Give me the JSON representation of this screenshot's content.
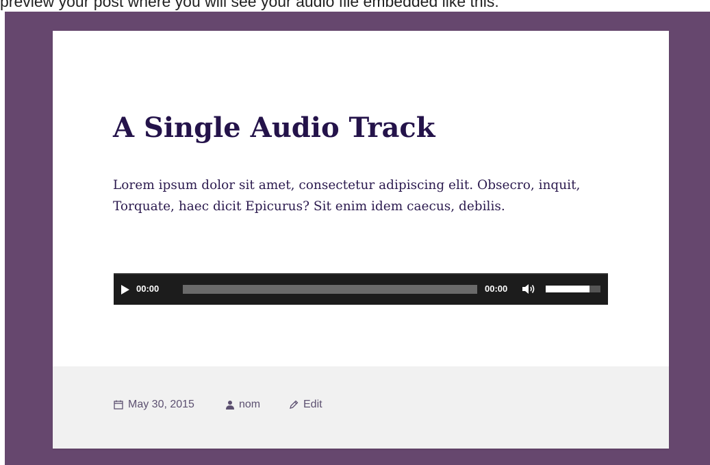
{
  "caption": "preview your post where you will see your audio file embedded like this:",
  "post": {
    "title": "A Single Audio Track",
    "body": "Lorem ipsum dolor sit amet, consectetur adipiscing elit. Obsecro, inquit, Torquate, haec dicit Epicurus? Sit enim idem caecus, debilis."
  },
  "audio_player": {
    "current_time": "00:00",
    "duration": "00:00",
    "progress_fraction": 0,
    "volume_fraction": 0.8,
    "play_icon": "play-icon",
    "mute_icon": "volume-icon"
  },
  "footer": {
    "date": "May 30, 2015",
    "author": "nom",
    "edit": "Edit",
    "date_icon": "calendar-icon",
    "author_icon": "user-icon",
    "edit_icon": "pencil-icon"
  },
  "colors": {
    "frame_background": "#66476e",
    "title_color": "#24134a",
    "player_background": "#1c1c1c",
    "footer_background": "#f1f1f1"
  }
}
